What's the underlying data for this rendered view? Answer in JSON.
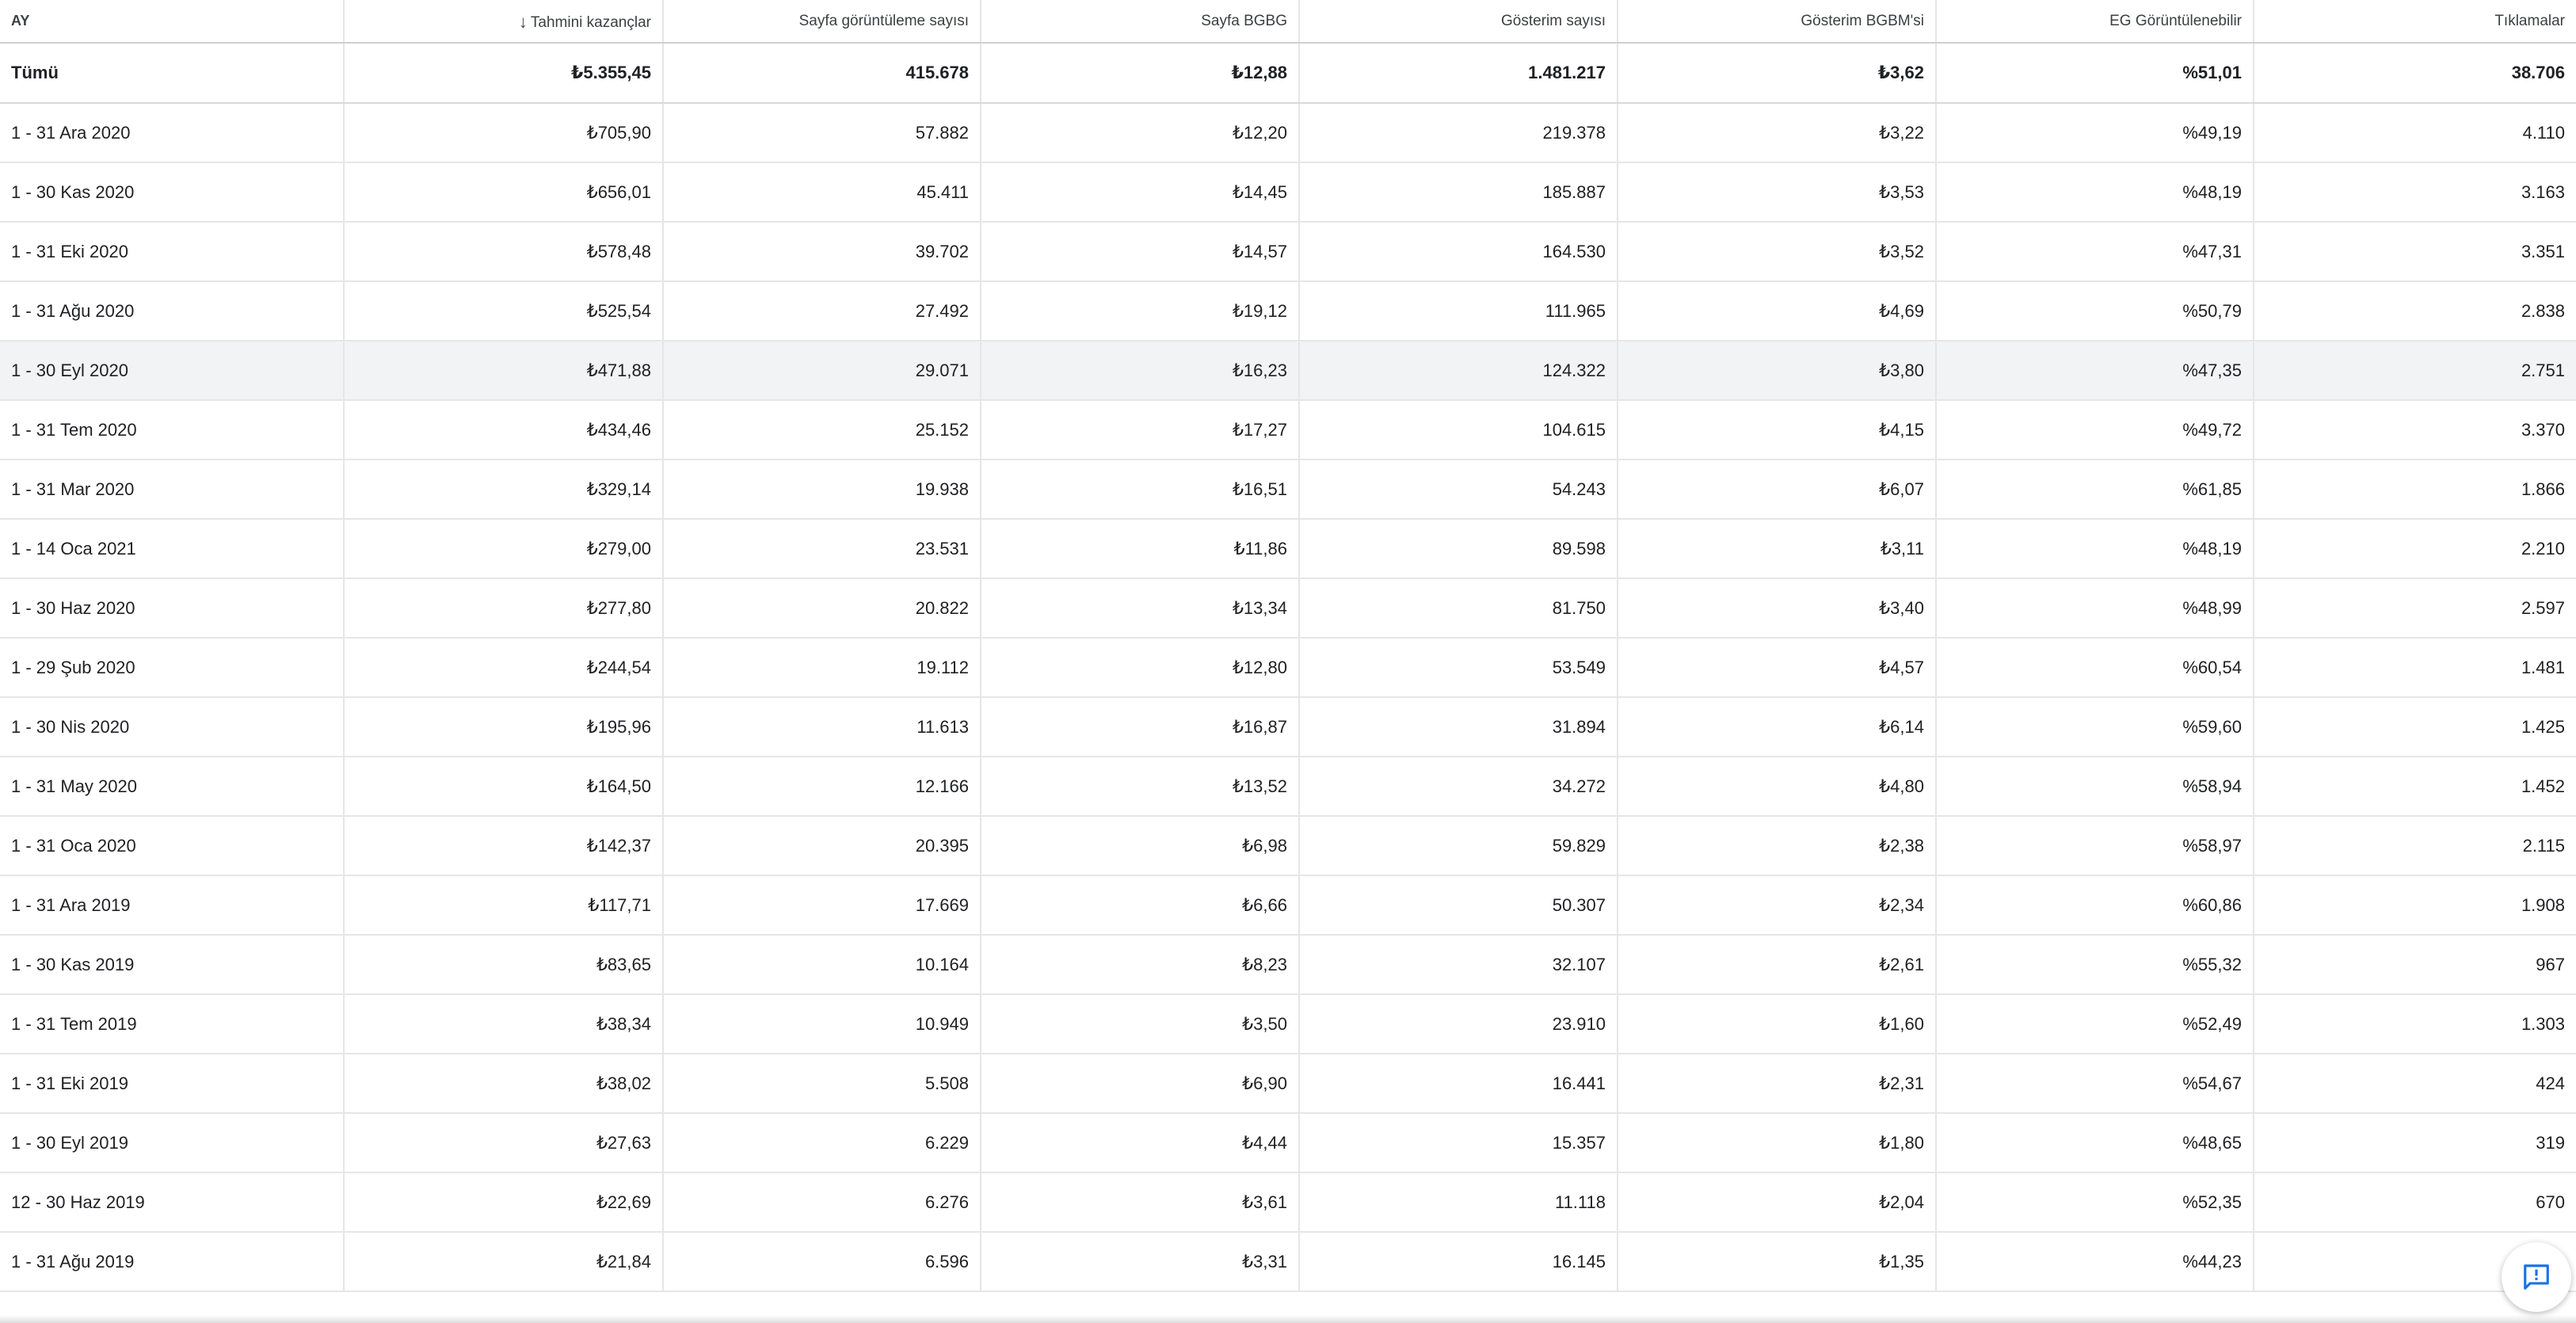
{
  "table": {
    "columns": [
      {
        "key": "month",
        "label": "AY"
      },
      {
        "key": "earnings",
        "label": "Tahmini kazançlar",
        "sorted": "descending"
      },
      {
        "key": "pageviews",
        "label": "Sayfa görüntüleme sayısı"
      },
      {
        "key": "page_rpm",
        "label": "Sayfa BGBG"
      },
      {
        "key": "impressions",
        "label": "Gösterim sayısı"
      },
      {
        "key": "impression_rpm",
        "label": "Gösterim BGBM'si"
      },
      {
        "key": "viewable",
        "label": "EG Görüntülenebilir"
      },
      {
        "key": "clicks",
        "label": "Tıklamalar"
      }
    ],
    "total": {
      "month": "Tümü",
      "earnings": "₺5.355,45",
      "pageviews": "415.678",
      "page_rpm": "₺12,88",
      "impressions": "1.481.217",
      "impression_rpm": "₺3,62",
      "viewable": "%51,01",
      "clicks": "38.706"
    },
    "rows": [
      {
        "month": "1 - 31 Ara 2020",
        "earnings": "₺705,90",
        "pageviews": "57.882",
        "page_rpm": "₺12,20",
        "impressions": "219.378",
        "impression_rpm": "₺3,22",
        "viewable": "%49,19",
        "clicks": "4.110"
      },
      {
        "month": "1 - 30 Kas 2020",
        "earnings": "₺656,01",
        "pageviews": "45.411",
        "page_rpm": "₺14,45",
        "impressions": "185.887",
        "impression_rpm": "₺3,53",
        "viewable": "%48,19",
        "clicks": "3.163"
      },
      {
        "month": "1 - 31 Eki 2020",
        "earnings": "₺578,48",
        "pageviews": "39.702",
        "page_rpm": "₺14,57",
        "impressions": "164.530",
        "impression_rpm": "₺3,52",
        "viewable": "%47,31",
        "clicks": "3.351"
      },
      {
        "month": "1 - 31 Ağu 2020",
        "earnings": "₺525,54",
        "pageviews": "27.492",
        "page_rpm": "₺19,12",
        "impressions": "111.965",
        "impression_rpm": "₺4,69",
        "viewable": "%50,79",
        "clicks": "2.838"
      },
      {
        "month": "1 - 30 Eyl 2020",
        "earnings": "₺471,88",
        "pageviews": "29.071",
        "page_rpm": "₺16,23",
        "impressions": "124.322",
        "impression_rpm": "₺3,80",
        "viewable": "%47,35",
        "clicks": "2.751",
        "highlighted": true
      },
      {
        "month": "1 - 31 Tem 2020",
        "earnings": "₺434,46",
        "pageviews": "25.152",
        "page_rpm": "₺17,27",
        "impressions": "104.615",
        "impression_rpm": "₺4,15",
        "viewable": "%49,72",
        "clicks": "3.370"
      },
      {
        "month": "1 - 31 Mar 2020",
        "earnings": "₺329,14",
        "pageviews": "19.938",
        "page_rpm": "₺16,51",
        "impressions": "54.243",
        "impression_rpm": "₺6,07",
        "viewable": "%61,85",
        "clicks": "1.866"
      },
      {
        "month": "1 - 14 Oca 2021",
        "earnings": "₺279,00",
        "pageviews": "23.531",
        "page_rpm": "₺11,86",
        "impressions": "89.598",
        "impression_rpm": "₺3,11",
        "viewable": "%48,19",
        "clicks": "2.210"
      },
      {
        "month": "1 - 30 Haz 2020",
        "earnings": "₺277,80",
        "pageviews": "20.822",
        "page_rpm": "₺13,34",
        "impressions": "81.750",
        "impression_rpm": "₺3,40",
        "viewable": "%48,99",
        "clicks": "2.597"
      },
      {
        "month": "1 - 29 Şub 2020",
        "earnings": "₺244,54",
        "pageviews": "19.112",
        "page_rpm": "₺12,80",
        "impressions": "53.549",
        "impression_rpm": "₺4,57",
        "viewable": "%60,54",
        "clicks": "1.481"
      },
      {
        "month": "1 - 30 Nis 2020",
        "earnings": "₺195,96",
        "pageviews": "11.613",
        "page_rpm": "₺16,87",
        "impressions": "31.894",
        "impression_rpm": "₺6,14",
        "viewable": "%59,60",
        "clicks": "1.425"
      },
      {
        "month": "1 - 31 May 2020",
        "earnings": "₺164,50",
        "pageviews": "12.166",
        "page_rpm": "₺13,52",
        "impressions": "34.272",
        "impression_rpm": "₺4,80",
        "viewable": "%58,94",
        "clicks": "1.452"
      },
      {
        "month": "1 - 31 Oca 2020",
        "earnings": "₺142,37",
        "pageviews": "20.395",
        "page_rpm": "₺6,98",
        "impressions": "59.829",
        "impression_rpm": "₺2,38",
        "viewable": "%58,97",
        "clicks": "2.115"
      },
      {
        "month": "1 - 31 Ara 2019",
        "earnings": "₺117,71",
        "pageviews": "17.669",
        "page_rpm": "₺6,66",
        "impressions": "50.307",
        "impression_rpm": "₺2,34",
        "viewable": "%60,86",
        "clicks": "1.908"
      },
      {
        "month": "1 - 30 Kas 2019",
        "earnings": "₺83,65",
        "pageviews": "10.164",
        "page_rpm": "₺8,23",
        "impressions": "32.107",
        "impression_rpm": "₺2,61",
        "viewable": "%55,32",
        "clicks": "967"
      },
      {
        "month": "1 - 31 Tem 2019",
        "earnings": "₺38,34",
        "pageviews": "10.949",
        "page_rpm": "₺3,50",
        "impressions": "23.910",
        "impression_rpm": "₺1,60",
        "viewable": "%52,49",
        "clicks": "1.303"
      },
      {
        "month": "1 - 31 Eki 2019",
        "earnings": "₺38,02",
        "pageviews": "5.508",
        "page_rpm": "₺6,90",
        "impressions": "16.441",
        "impression_rpm": "₺2,31",
        "viewable": "%54,67",
        "clicks": "424"
      },
      {
        "month": "1 - 30 Eyl 2019",
        "earnings": "₺27,63",
        "pageviews": "6.229",
        "page_rpm": "₺4,44",
        "impressions": "15.357",
        "impression_rpm": "₺1,80",
        "viewable": "%48,65",
        "clicks": "319"
      },
      {
        "month": "12 - 30 Haz 2019",
        "earnings": "₺22,69",
        "pageviews": "6.276",
        "page_rpm": "₺3,61",
        "impressions": "11.118",
        "impression_rpm": "₺2,04",
        "viewable": "%52,35",
        "clicks": "670"
      },
      {
        "month": "1 - 31 Ağu 2019",
        "earnings": "₺21,84",
        "pageviews": "6.596",
        "page_rpm": "₺3,31",
        "impressions": "16.145",
        "impression_rpm": "₺1,35",
        "viewable": "%44,23",
        "clicks": ""
      }
    ]
  },
  "sort_icon": "arrow-down-icon",
  "feedback_button": {
    "icon": "feedback-icon",
    "color": "#1a73e8"
  },
  "colors": {
    "highlight_row": "#f1f3f4",
    "grid_line": "#e6e6e6",
    "text": "#202124"
  }
}
